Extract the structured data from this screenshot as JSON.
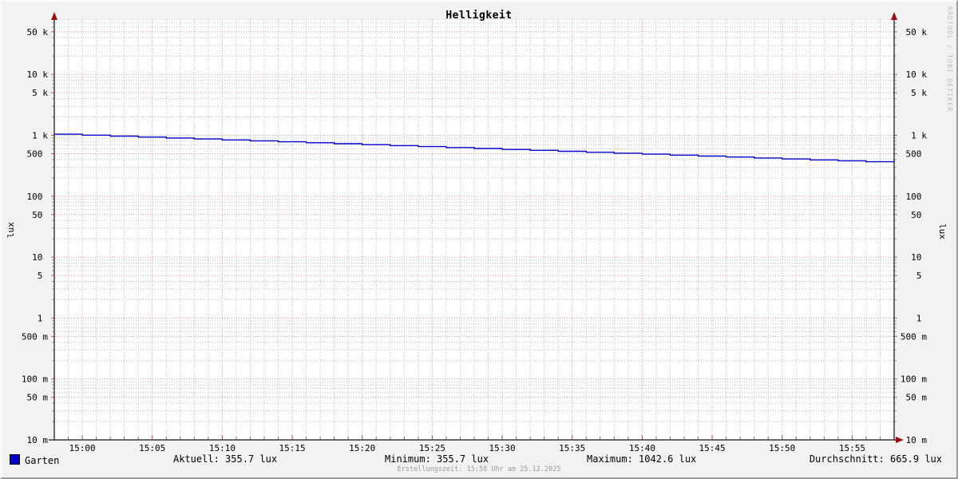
{
  "title": "Helligkeit",
  "watermark": "RRDTOOL / TOBI OETIKER",
  "footer": "Erstellungszeit: 15:58 Uhr am 25.12.2025",
  "legend": {
    "series": {
      "label": "Garten",
      "color": "#0000CC"
    },
    "items": [
      {
        "name": "aktuell",
        "text": "Aktuell: 355.7 lux"
      },
      {
        "name": "minimum",
        "text": "Minimum: 355.7 lux"
      },
      {
        "name": "maximum",
        "text": "Maximum: 1042.6 lux"
      },
      {
        "name": "durchschnitt",
        "text": "Durchschnitt: 665.9 lux"
      }
    ]
  },
  "chart_data": {
    "type": "line",
    "title": "Helligkeit",
    "xlabel": "",
    "ylabel": "lux",
    "y_scale": "log",
    "ylim": [
      0.01,
      80000
    ],
    "grid": true,
    "legend_position": "bottom",
    "stats": {
      "aktuell_lux": 355.7,
      "minimum_lux": 355.7,
      "maximum_lux": 1042.6,
      "durchschnitt_lux": 665.9
    },
    "y_axis": {
      "ticks": [
        {
          "label": "50 k",
          "value": 50000
        },
        {
          "label": "10 k",
          "value": 10000
        },
        {
          "label": "5 k",
          "value": 5000
        },
        {
          "label": "1 k",
          "value": 1000
        },
        {
          "label": "500",
          "value": 500
        },
        {
          "label": "100",
          "value": 100
        },
        {
          "label": "50",
          "value": 50
        },
        {
          "label": "10",
          "value": 10
        },
        {
          "label": "5",
          "value": 5
        },
        {
          "label": "1",
          "value": 1
        },
        {
          "label": "500 m",
          "value": 0.5
        },
        {
          "label": "100 m",
          "value": 0.1
        },
        {
          "label": "50 m",
          "value": 0.05
        },
        {
          "label": "10 m",
          "value": 0.01
        }
      ]
    },
    "x_axis": {
      "start_minutes": -2,
      "end_minutes": 58,
      "minor_step_minutes": 1,
      "ticks": [
        {
          "label": "15:00",
          "minutes": 0
        },
        {
          "label": "15:05",
          "minutes": 5
        },
        {
          "label": "15:10",
          "minutes": 10
        },
        {
          "label": "15:15",
          "minutes": 15
        },
        {
          "label": "15:20",
          "minutes": 20
        },
        {
          "label": "15:25",
          "minutes": 25
        },
        {
          "label": "15:30",
          "minutes": 30
        },
        {
          "label": "15:35",
          "minutes": 35
        },
        {
          "label": "15:40",
          "minutes": 40
        },
        {
          "label": "15:45",
          "minutes": 45
        },
        {
          "label": "15:50",
          "minutes": 50
        },
        {
          "label": "15:55",
          "minutes": 55
        }
      ]
    },
    "series": [
      {
        "name": "Garten",
        "color": "#0000CC",
        "start_time": "14:58",
        "end_time": "15:58",
        "start_minutes": -2,
        "step_minutes": 2,
        "values": [
          1042.6,
          1005.8,
          970.3,
          936.1,
          903.0,
          871.2,
          840.4,
          810.8,
          782.2,
          754.6,
          728.0,
          702.3,
          677.5,
          653.6,
          630.6,
          608.3,
          586.9,
          566.2,
          546.2,
          526.9,
          508.3,
          490.4,
          473.1,
          456.4,
          440.3,
          424.8,
          409.8,
          395.3,
          381.4,
          367.9,
          355.7
        ]
      }
    ],
    "colors": {
      "background": "#f2f2f2",
      "canvas": "#ffffff",
      "grid_major": "#e89a9a",
      "grid_minor": "#b7bfd2",
      "axis": "#3a3a3a",
      "arrow": "#991111",
      "line": "#0000CC",
      "text": "#000000",
      "footer_text": "#9a9a9a",
      "watermark_text": "#bbbbbb"
    }
  }
}
